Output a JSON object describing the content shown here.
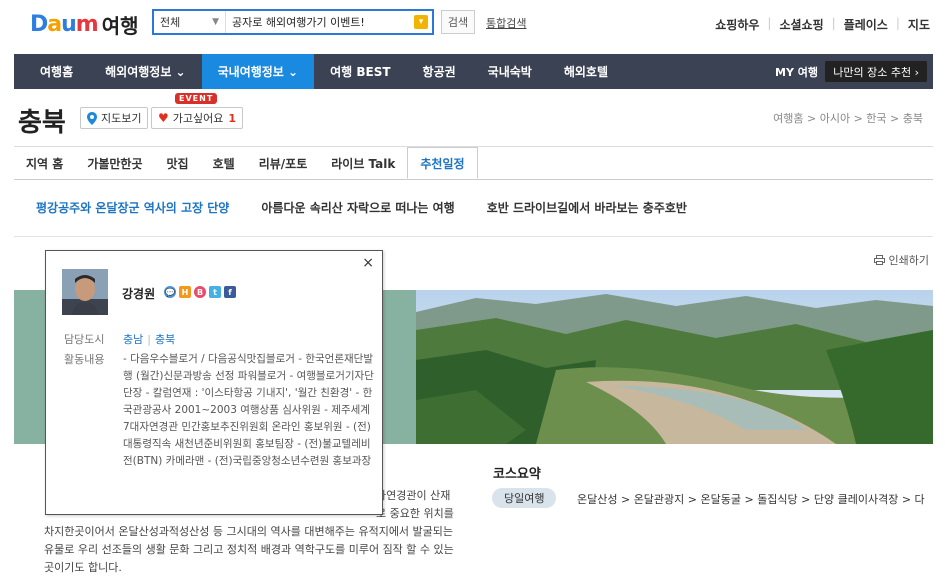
{
  "header": {
    "brand_letters": [
      "D",
      "a",
      "u",
      "m"
    ],
    "service_name": "여행",
    "search": {
      "scope": "전체",
      "value": "공자로 해외여행가기 이벤트!",
      "button": "검색"
    },
    "total_search": "통합검색",
    "util_nav": [
      "쇼핑하우",
      "소셜쇼핑",
      "플레이스",
      "지도"
    ]
  },
  "gnb": {
    "items": [
      "여행홈",
      "해외여행정보 ⌄",
      "국내여행정보 ⌄",
      "여행 BEST",
      "항공권",
      "국내숙박",
      "해외호텔"
    ],
    "active_index": 2,
    "my_travel": "MY 여행",
    "my_place": "나만의 장소 추천 ›"
  },
  "region": {
    "title": "충북",
    "map_button": "지도보기",
    "wish_button": "가고싶어요",
    "wish_count": "1",
    "event_badge": "EVENT",
    "breadcrumb": "여행홈 > 아시아 > 한국 > 충북"
  },
  "subtabs": {
    "items": [
      "지역 홈",
      "가볼만한곳",
      "맛집",
      "호텔",
      "리뷰/포토",
      "라이브 Talk",
      "추천일정"
    ],
    "active_index": 6
  },
  "course_links": [
    "평강공주와 온달장군 역사의 고장 단양",
    "아름다운 속리산 자락으로 떠나는 여행",
    "호반 드라이브길에서 바라보는 충주호반"
  ],
  "print_label": "인쇄하기",
  "summary": {
    "title": "코스요약",
    "pill": "당일여행",
    "route": "온달산성 > 온달관광지 > 온달동굴 > 돌집식당 > 단양 클레이사격장 > 다"
  },
  "intro": {
    "right_fragments": [
      "자연경관이 산재",
      "로 중요한 위치를"
    ],
    "lines": [
      "차지한곳이어서 온달산성과적성산성 등 그시대의 역사를 대변해주는 유적지에서 발굴되는",
      "유물로 우리 선조들의 생활 문화 그리고 정치적 배경과 역학구도를 미루어 짐작 할 수 있는",
      "곳이기도 합니다."
    ]
  },
  "popup": {
    "author": "강경원",
    "sns": [
      "M",
      "H",
      "B",
      "t",
      "f"
    ],
    "city_label": "담당도시",
    "cities": [
      "충남",
      "충북"
    ],
    "activity_label": "활동내용",
    "activity": "- 다음우수블로거 / 다음공식맛집블로거 - 한국언론재단발행 (월간)신문과방송 선정 파워블로거 - 여행블로거기자단 단장 - 칼럼연재 : '이스타항공 기내지', '월간 친환경' - 한국관광공사 2001~2003 여행상품 심사위원 - 제주세계7대자연경관 민간홍보추진위원회 온라인 홍보위원 - (전)대통령직속 새천년준비위원회 홍보팀장 - (전)불교텔레비전(BTN) 카메라맨 - (전)국립중앙청소년수련원 홍보과장",
    "close": "×"
  },
  "colors": {
    "gnb_bg": "#3b4254",
    "gnb_active": "#1a8ae0",
    "link_blue": "#1c74c4",
    "hero_green": "#87b1a1"
  }
}
